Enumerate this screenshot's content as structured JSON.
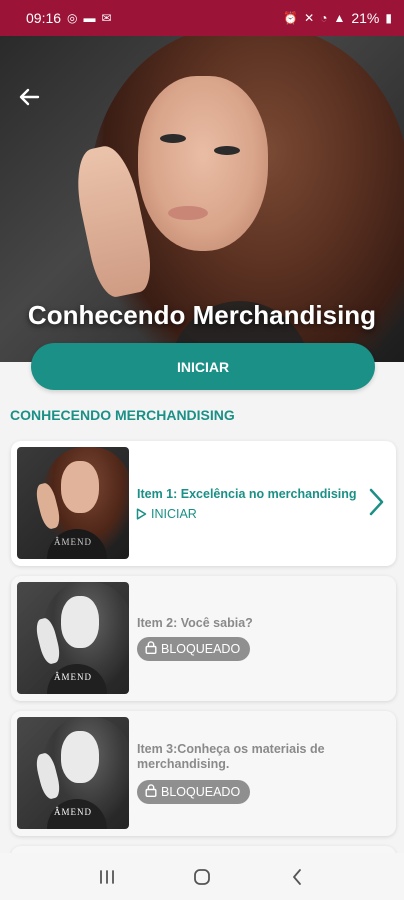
{
  "status_bar": {
    "time": "09:16",
    "battery": "21%"
  },
  "hero": {
    "title": "Conhecendo Merchandising"
  },
  "start_button": {
    "label": "INICIAR"
  },
  "section": {
    "title": "CONHECENDO MERCHANDISING"
  },
  "items": [
    {
      "title": "Item 1: Excelência no merchandising",
      "status": "INICIAR",
      "thumb_logo": "ÂMEND"
    },
    {
      "title": "Item 2: Você sabia?",
      "status": "BLOQUEADO",
      "thumb_logo": "ÂMEND"
    },
    {
      "title": "Item 3:Conheça os materiais de merchandising.",
      "status": "BLOQUEADO",
      "thumb_logo": "ÂMEND"
    }
  ],
  "colors": {
    "accent": "#1a9086",
    "status_bar": "#9b1438",
    "locked": "#8f8f8f"
  },
  "icons": [
    "back-arrow-icon",
    "play-icon",
    "lock-icon",
    "chevron-right-icon",
    "recents-icon",
    "home-icon",
    "back-icon"
  ]
}
